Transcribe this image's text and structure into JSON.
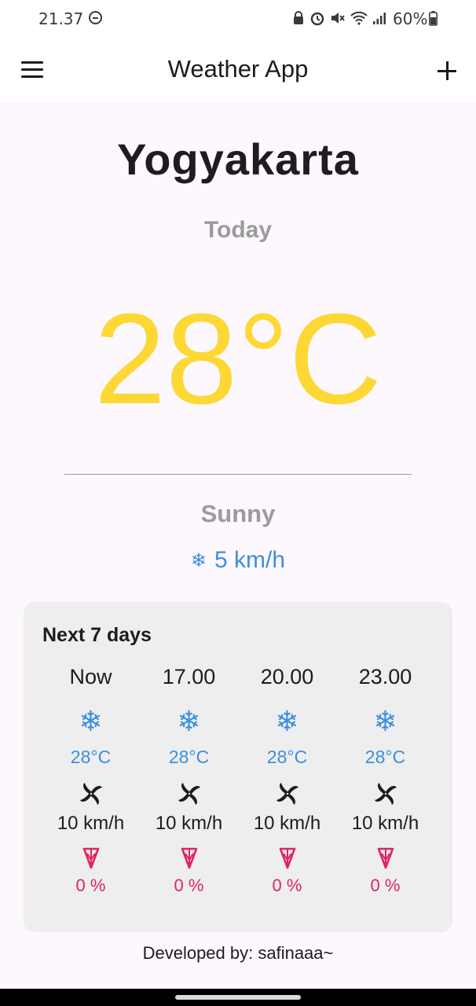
{
  "status": {
    "time": "21.37",
    "battery": "60%"
  },
  "appbar": {
    "title": "Weather App"
  },
  "main": {
    "city": "Yogyakarta",
    "day": "Today",
    "temperature": "28°C",
    "condition": "Sunny",
    "wind_icon": "❄",
    "wind": "5 km/h"
  },
  "forecast": {
    "title": "Next 7 days",
    "items": [
      {
        "time": "Now",
        "icon": "❄",
        "temp": "28°C",
        "wind": "10 km/h",
        "rain": "0 %"
      },
      {
        "time": "17.00",
        "icon": "❄",
        "temp": "28°C",
        "wind": "10 km/h",
        "rain": "0 %"
      },
      {
        "time": "20.00",
        "icon": "❄",
        "temp": "28°C",
        "wind": "10 km/h",
        "rain": "0 %"
      },
      {
        "time": "23.00",
        "icon": "❄",
        "temp": "28°C",
        "wind": "10 km/h",
        "rain": "0 %"
      }
    ]
  },
  "footer": {
    "credit": "Developed by: safinaaa~"
  },
  "colors": {
    "temperature": "#fdd835",
    "accent_blue": "#3b8fe0",
    "rain_pink": "#e0245e"
  }
}
